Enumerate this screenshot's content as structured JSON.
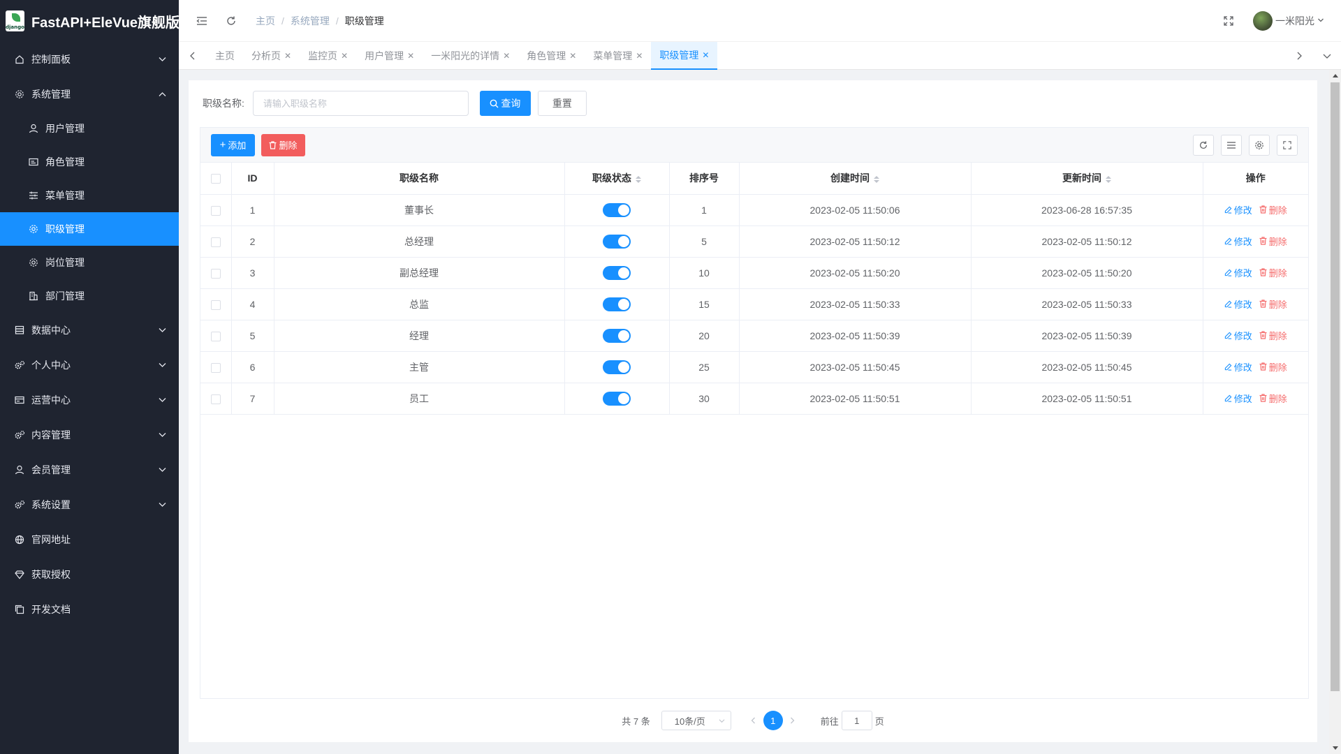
{
  "app": {
    "title": "FastAPI+EleVue旗舰版",
    "logo_text": "django"
  },
  "colors": {
    "sidebar_bg": "#1f2430",
    "primary": "#1890ff",
    "danger": "#f56c6c"
  },
  "sidebar": {
    "items": [
      {
        "label": "控制面板",
        "icon": "home-icon",
        "expanded": false
      },
      {
        "label": "系统管理",
        "icon": "gear-icon",
        "expanded": true,
        "children": [
          {
            "label": "用户管理",
            "icon": "user-icon"
          },
          {
            "label": "角色管理",
            "icon": "id-card-icon"
          },
          {
            "label": "菜单管理",
            "icon": "sliders-icon"
          },
          {
            "label": "职级管理",
            "icon": "gear-icon",
            "active": true
          },
          {
            "label": "岗位管理",
            "icon": "gear-icon"
          },
          {
            "label": "部门管理",
            "icon": "building-icon"
          }
        ]
      },
      {
        "label": "数据中心",
        "icon": "database-icon",
        "expanded": false
      },
      {
        "label": "个人中心",
        "icon": "gears-icon",
        "expanded": false
      },
      {
        "label": "运营中心",
        "icon": "card-icon",
        "expanded": false
      },
      {
        "label": "内容管理",
        "icon": "gears-icon",
        "expanded": false
      },
      {
        "label": "会员管理",
        "icon": "user-icon",
        "expanded": false
      },
      {
        "label": "系统设置",
        "icon": "gears-icon",
        "expanded": false
      },
      {
        "label": "官网地址",
        "icon": "globe-icon"
      },
      {
        "label": "获取授权",
        "icon": "diamond-icon"
      },
      {
        "label": "开发文档",
        "icon": "copy-icon"
      }
    ]
  },
  "header": {
    "breadcrumb": [
      "主页",
      "系统管理",
      "职级管理"
    ],
    "user_name": "一米阳光"
  },
  "tabs": [
    {
      "label": "主页",
      "closable": false
    },
    {
      "label": "分析页",
      "closable": true
    },
    {
      "label": "监控页",
      "closable": true
    },
    {
      "label": "用户管理",
      "closable": true
    },
    {
      "label": "一米阳光的详情",
      "closable": true
    },
    {
      "label": "角色管理",
      "closable": true
    },
    {
      "label": "菜单管理",
      "closable": true
    },
    {
      "label": "职级管理",
      "closable": true,
      "active": true
    }
  ],
  "search": {
    "label": "职级名称:",
    "placeholder": "请输入职级名称",
    "value": "",
    "query_label": "查询",
    "reset_label": "重置"
  },
  "toolbar": {
    "add_label": "添加",
    "delete_label": "删除"
  },
  "table": {
    "columns": [
      "ID",
      "职级名称",
      "职级状态",
      "排序号",
      "创建时间",
      "更新时间",
      "操作"
    ],
    "edit_label": "修改",
    "delete_label": "删除",
    "rows": [
      {
        "id": "1",
        "name": "董事长",
        "enabled": true,
        "sort": "1",
        "created": "2023-02-05 11:50:06",
        "updated": "2023-06-28 16:57:35"
      },
      {
        "id": "2",
        "name": "总经理",
        "enabled": true,
        "sort": "5",
        "created": "2023-02-05 11:50:12",
        "updated": "2023-02-05 11:50:12"
      },
      {
        "id": "3",
        "name": "副总经理",
        "enabled": true,
        "sort": "10",
        "created": "2023-02-05 11:50:20",
        "updated": "2023-02-05 11:50:20"
      },
      {
        "id": "4",
        "name": "总监",
        "enabled": true,
        "sort": "15",
        "created": "2023-02-05 11:50:33",
        "updated": "2023-02-05 11:50:33"
      },
      {
        "id": "5",
        "name": "经理",
        "enabled": true,
        "sort": "20",
        "created": "2023-02-05 11:50:39",
        "updated": "2023-02-05 11:50:39"
      },
      {
        "id": "6",
        "name": "主管",
        "enabled": true,
        "sort": "25",
        "created": "2023-02-05 11:50:45",
        "updated": "2023-02-05 11:50:45"
      },
      {
        "id": "7",
        "name": "员工",
        "enabled": true,
        "sort": "30",
        "created": "2023-02-05 11:50:51",
        "updated": "2023-02-05 11:50:51"
      }
    ]
  },
  "pagination": {
    "total_label": "共 7 条",
    "page_size_label": "10条/页",
    "current_page": "1",
    "goto_label": "前往",
    "goto_value": "1",
    "page_suffix": "页"
  }
}
